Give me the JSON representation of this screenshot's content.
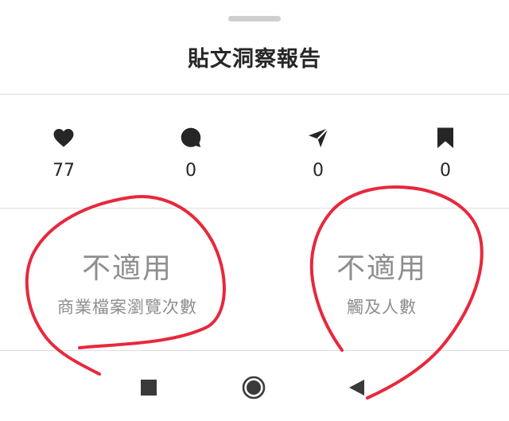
{
  "sheet": {
    "title": "貼文洞察報告"
  },
  "stats": [
    {
      "icon": "heart-icon",
      "value": "77"
    },
    {
      "icon": "comment-icon",
      "value": "0"
    },
    {
      "icon": "share-icon",
      "value": "0"
    },
    {
      "icon": "bookmark-icon",
      "value": "0"
    }
  ],
  "metrics": [
    {
      "value": "不適用",
      "label": "商業檔案瀏覽次數"
    },
    {
      "value": "不適用",
      "label": "觸及人數"
    }
  ],
  "navbar": {
    "icons": [
      "recents-square-icon",
      "home-circle-icon",
      "back-triangle-icon"
    ]
  },
  "colors": {
    "annotation": "#e8283c",
    "muted_text": "#8e8e8e",
    "icon": "#262626"
  }
}
